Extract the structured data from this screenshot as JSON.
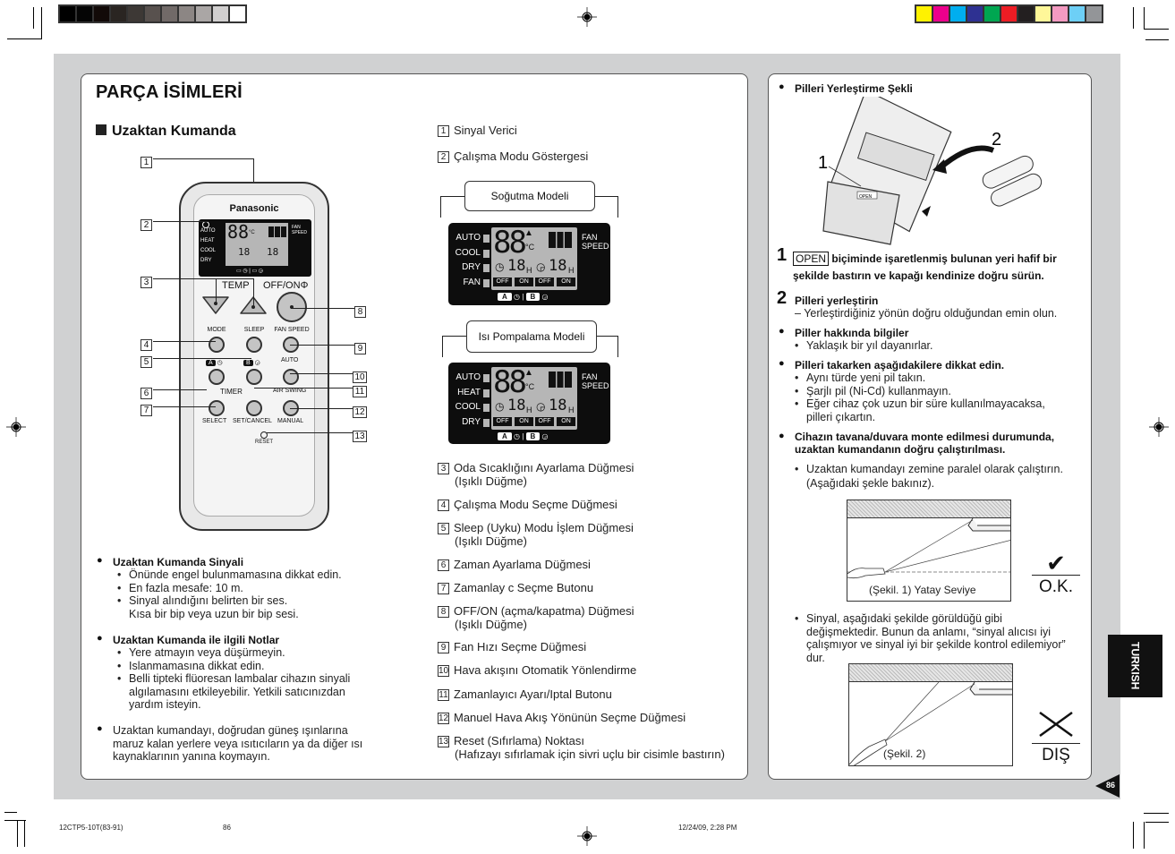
{
  "print_marks": {
    "grayscale_swatches": [
      "#000000",
      "#050505",
      "#120a08",
      "#2a2522",
      "#3d3835",
      "#58514e",
      "#716a68",
      "#8c8684",
      "#aaa6a5",
      "#d1cfcf",
      "#ffffff"
    ],
    "color_swatches": [
      "#fff200",
      "#ec008c",
      "#00aeef",
      "#2e3192",
      "#00a651",
      "#ed1c24",
      "#231f20",
      "#fff799",
      "#f49ac1",
      "#6dcff6",
      "#939598"
    ]
  },
  "left_page": {
    "title": "PARÇA İSİMLERİ",
    "section_title": "Uzaktan Kumanda",
    "remote": {
      "brand": "Panasonic",
      "lcd_modes": [
        "AUTO",
        "HEAT",
        "COOL",
        "DRY"
      ],
      "lcd_fan_label": "FAN SPEED",
      "lcd_digits": "88",
      "lcd_unit": "°C",
      "timer_digits": "18",
      "timer_unit": "H",
      "lcd_off": "OFF",
      "lcd_on": "ON",
      "lcd_a": "A",
      "lcd_b": "B",
      "temp_label": "TEMP",
      "offon_label": "OFF/ON",
      "mode_label": "MODE",
      "sleep_label": "SLEEP",
      "fanspeed_label": "FAN SPEED",
      "auto_label": "AUTO",
      "timer_label": "TIMER",
      "airswing_label": "AIR SWING",
      "select_label": "SELECT",
      "setcancel_label": "SET/CANCEL",
      "manual_label": "MANUAL",
      "reset_label": "RESET",
      "timer_a_label": "A",
      "timer_b_label": "B"
    },
    "callouts": [
      "1",
      "2",
      "3",
      "4",
      "5",
      "6",
      "7",
      "8",
      "9",
      "10",
      "11",
      "12",
      "13"
    ],
    "signal_section": {
      "heading": "Uzaktan Kumanda Sinyali",
      "items": [
        "Önünde engel bulunmamasına dikkat edin.",
        "En fazla mesafe:  10 m.",
        "Sinyal alındığını belirten bir ses."
      ],
      "continuation": "Kısa bir bip veya uzun bir bip sesi."
    },
    "notes_section": {
      "heading": "Uzaktan Kumanda ile ilgili Notlar",
      "items": [
        "Yere atmayın veya düşürmeyin.",
        "Islanmamasına dikkat edin.",
        "Belli tipteki flüoresan lambalar cihazın sinyali"
      ],
      "continuation1": "algılamasını etkileyebilir. Yetkili satıcınızdan",
      "continuation2": "yardım isteyin."
    },
    "sun_warning": [
      "Uzaktan kumandayı, doğrudan güneş ışınlarına",
      "maruz kalan yerlere veya ısıtıcıların ya da diğer ısı",
      "kaynaklarının yanına koymayın."
    ]
  },
  "parts": {
    "items": [
      {
        "num": "1",
        "text": "Sinyal Verici",
        "sub": ""
      },
      {
        "num": "2",
        "text": "Çalışma Modu Göstergesi",
        "sub": ""
      },
      {
        "num": "3",
        "text": "Oda Sıcaklığını Ayarlama Düğmesi",
        "sub": "(Işıklı Düğme)"
      },
      {
        "num": "4",
        "text": "Çalışma Modu Seçme Düğmesi",
        "sub": ""
      },
      {
        "num": "5",
        "text": "Sleep (Uyku) Modu İşlem Düğmesi",
        "sub": "(Işıklı Düğme)"
      },
      {
        "num": "6",
        "text": "Zaman Ayarlama Düğmesi",
        "sub": ""
      },
      {
        "num": "7",
        "text": "Zamanlay c Seçme Butonu",
        "sub": ""
      },
      {
        "num": "8",
        "text": "OFF/ON (açma/kapatma) Düğmesi",
        "sub": "(Işıklı Düğme)"
      },
      {
        "num": "9",
        "text": "Fan Hızı Seçme Düğmesi",
        "sub": ""
      },
      {
        "num": "10",
        "text": "Hava akışını Otomatik Yönlendirme",
        "sub": ""
      },
      {
        "num": "11",
        "text": "Zamanlayıcı Ayarı/Iptal Butonu",
        "sub": ""
      },
      {
        "num": "12",
        "text": "Manuel Hava Akış Yönünün Seçme Düğmesi",
        "sub": ""
      },
      {
        "num": "13",
        "text": "Reset (Sıfırlama) Noktası",
        "sub": "(Hafızayı sıfırlamak için sivri uçlu bir cisimle bastırın)"
      }
    ],
    "cooling_model": {
      "label": "Soğutma Modeli",
      "modes": [
        "AUTO",
        "COOL",
        "DRY",
        "FAN"
      ]
    },
    "heatpump_model": {
      "label": "Isı Pompalama Modeli",
      "modes": [
        "AUTO",
        "HEAT",
        "COOL",
        "DRY"
      ]
    },
    "lcd_fan_line1": "FAN",
    "lcd_fan_line2": "SPEED"
  },
  "right_page": {
    "battery_heading": "Pilleri Yerleştirme Şekli",
    "illus_label_1": "1",
    "illus_label_2": "2",
    "illus_open": "OPEN",
    "step1_num": "1",
    "step1_open": "OPEN",
    "step1_text": "biçiminde işaretlenmiş bulunan yeri hafif bir",
    "step1_cont": "şekilde bastırın ve kapağı kendinize doğru sürün.",
    "step2_num": "2",
    "step2_heading": "Pilleri yerleştirin",
    "step2_text": "– Yerleştirdiğiniz yönün doğru olduğundan emin olun.",
    "info_heading": "Piller hakkında bilgiler",
    "info_items": [
      "Yaklaşık bir yıl dayanırlar."
    ],
    "caution_heading": "Pilleri takarken aşağıdakilere dikkat edin.",
    "caution_items": [
      "Aynı türde yeni pil takın.",
      "Şarjlı pil (Ni-Cd) kullanmayın.",
      "Eğer cihaz çok uzun bir süre kullanılmayacaksa,"
    ],
    "caution_cont": "pilleri çıkartın.",
    "mount_heading_1": "Cihazın tavana/duvara monte edilmesi durumunda,",
    "mount_heading_2": "uzaktan kumandanın doğru çalıştırılması.",
    "mount_item": "Uzaktan kumandayı zemine paralel olarak çalıştırın.",
    "mount_item_cont": "(Aşağıdaki şekle bakınız).",
    "fig1_caption": "(Şekil. 1) Yatay Seviye",
    "fig1_verdict": "O.K.",
    "signal_item": "Sinyal, aşağıdaki şekilde görüldüğü gibi",
    "signal_cont1": "değişmektedir. Bunun da anlamı, “sinyal alıcısı iyi",
    "signal_cont2": "çalışmıyor ve sinyal iyi bir şekilde kontrol edilemiyor”",
    "signal_cont3": "dur.",
    "fig2_caption": "(Şekil. 2)",
    "fig2_verdict": "DIŞ",
    "language_tab": "TURKISH",
    "page_number": "86"
  },
  "footer": {
    "doc_code": "12CTP5-10T(83-91)",
    "page": "86",
    "timestamp": "12/24/09, 2:28 PM"
  }
}
